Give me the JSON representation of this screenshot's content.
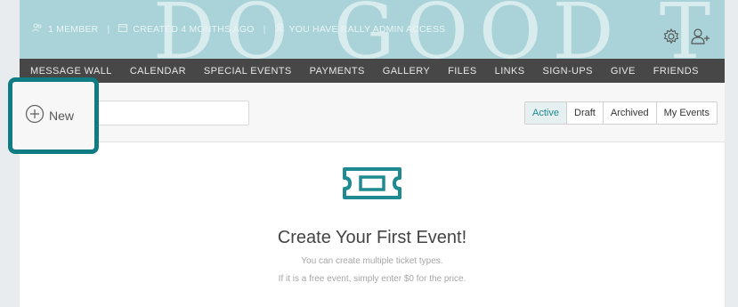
{
  "header": {
    "banner_text": "DO GOOD TODAY",
    "meta": {
      "members": "1 MEMBER",
      "created": "CREATED 4 MONTHS AGO",
      "access": "YOU HAVE RALLY ADMIN ACCESS"
    },
    "icons": [
      "gear-icon",
      "add-person-icon"
    ]
  },
  "nav": {
    "items": [
      {
        "label": "MESSAGE WALL"
      },
      {
        "label": "CALENDAR"
      },
      {
        "label": "SPECIAL EVENTS"
      },
      {
        "label": "PAYMENTS"
      },
      {
        "label": "GALLERY"
      },
      {
        "label": "FILES"
      },
      {
        "label": "LINKS"
      },
      {
        "label": "SIGN-UPS"
      },
      {
        "label": "GIVE"
      },
      {
        "label": "FRIENDS"
      }
    ]
  },
  "toolbar": {
    "new_label": "New",
    "search_placeholder": "",
    "filters": [
      {
        "label": "Active",
        "active": true
      },
      {
        "label": "Draft",
        "active": false
      },
      {
        "label": "Archived",
        "active": false
      },
      {
        "label": "My Events",
        "active": false
      }
    ]
  },
  "empty_state": {
    "title": "Create Your First Event!",
    "line1": "You can create multiple ticket types.",
    "line2": "If it is a free event, simply enter $0 for the price."
  },
  "colors": {
    "accent": "#0f7c84",
    "banner": "#a9d3d8",
    "nav_bg": "#474747"
  }
}
